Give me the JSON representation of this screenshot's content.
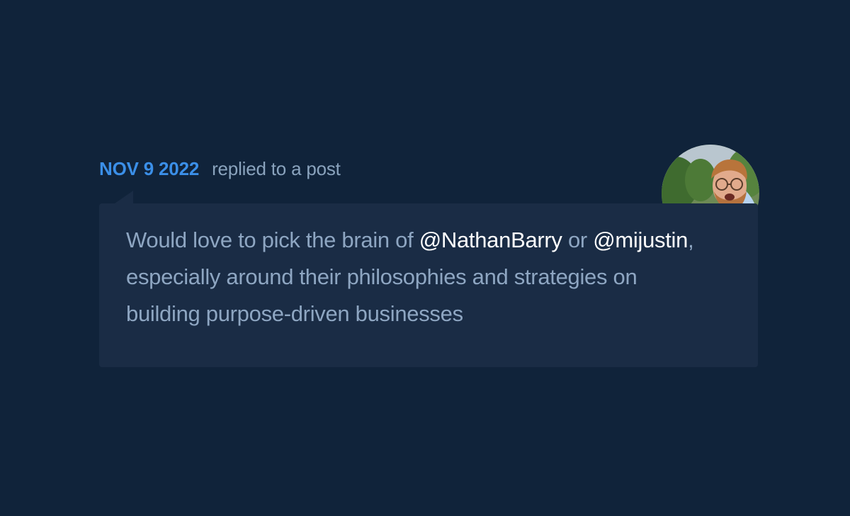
{
  "activity": {
    "date": "NOV 9 2022",
    "action": "replied to a post"
  },
  "post": {
    "text_before_mention_1": "Would love to pick the brain of ",
    "mention_1": "@NathanBarry",
    "text_between": " or ",
    "mention_2": "@mijustin",
    "text_after": ", especially around their philosophies and strategies on building purpose-driven businesses"
  },
  "colors": {
    "background": "#10233a",
    "card": "#1a2c45",
    "date_accent": "#3b8fe8",
    "muted_text": "#8ea6c2",
    "mention_text": "#ffffff"
  },
  "icons": {
    "avatar": "user-avatar-photo"
  }
}
